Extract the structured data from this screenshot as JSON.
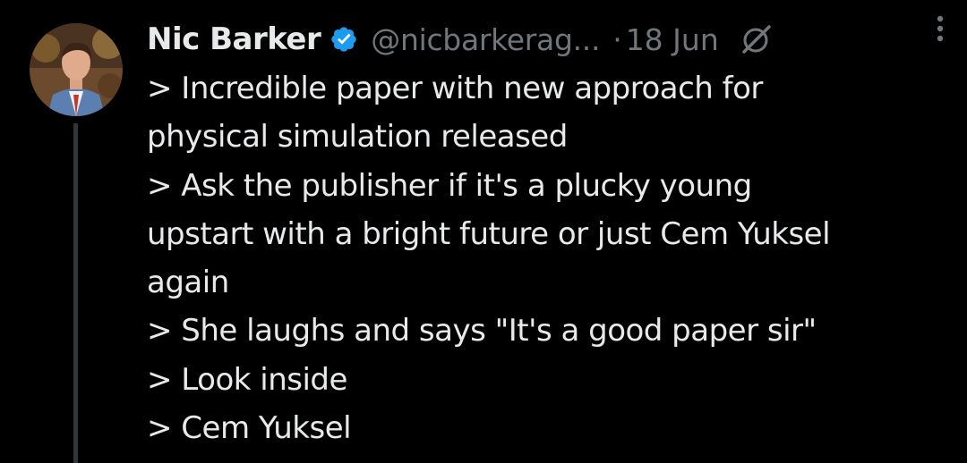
{
  "user": {
    "name": "Nic Barker",
    "handle": "@nicbarkerag...",
    "date": "18 Jun",
    "verified": true
  },
  "tweet": {
    "lines": [
      "> Incredible paper with new approach for",
      "physical simulation released",
      "> Ask the publisher if it's a plucky young",
      "upstart with a bright future or just Cem Yuksel",
      "again",
      "> She laughs and says \"It's a good paper sir\"",
      "> Look inside",
      "> Cem Yuksel"
    ]
  },
  "icons": {
    "verified": "verified-badge-icon",
    "grok": "grok-icon",
    "more": "more-options-icon"
  },
  "colors": {
    "background": "#000000",
    "text": "#e7e9ea",
    "secondary": "#71767b",
    "verified": "#1d9bf0"
  }
}
